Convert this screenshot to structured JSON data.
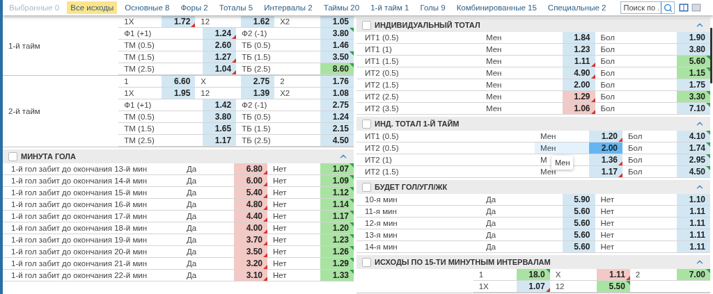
{
  "nav": {
    "tabs": [
      {
        "label": "Выбранные 0",
        "selected": false,
        "disabled": true
      },
      {
        "label": "Все исходы",
        "selected": true,
        "disabled": false
      },
      {
        "label": "Основные 8",
        "selected": false,
        "disabled": false
      },
      {
        "label": "Форы 2",
        "selected": false,
        "disabled": false
      },
      {
        "label": "Тоталы 5",
        "selected": false,
        "disabled": false
      },
      {
        "label": "Интервалы 2",
        "selected": false,
        "disabled": false
      },
      {
        "label": "Таймы 20",
        "selected": false,
        "disabled": false
      },
      {
        "label": "1-й тайм 1",
        "selected": false,
        "disabled": false
      },
      {
        "label": "Голы 9",
        "selected": false,
        "disabled": false
      },
      {
        "label": "Комбинированные 15",
        "selected": false,
        "disabled": false
      },
      {
        "label": "Специальные 2",
        "selected": false,
        "disabled": false
      }
    ],
    "search": {
      "placeholder": "Поиск по ."
    },
    "view_modes": [
      {
        "selected": true
      },
      {
        "selected": false
      }
    ]
  },
  "columns": [
    [
      {
        "kind": "periods",
        "periods": [
          {
            "label": "1-й тайм",
            "rows": [
              {
                "kind": "three",
                "outcomes": [
                  {
                    "label": "1X",
                    "odd": "1.72",
                    "color": "#d3e7f3",
                    "rising": false,
                    "falling": true
                  },
                  {
                    "label": "12",
                    "odd": "1.62",
                    "color": "#d3e7f3",
                    "rising": false,
                    "falling": false
                  },
                  {
                    "label": "X2",
                    "odd": "1.05",
                    "color": "#d3e7f3",
                    "rising": false,
                    "falling": false
                  }
                ]
              },
              {
                "kind": "two",
                "outcomes": [
                  {
                    "label": "Ф1 (+1)",
                    "odd": "1.24",
                    "color": "#d3e7f3",
                    "rising": false,
                    "falling": true
                  },
                  {
                    "label": "Ф2 (-1)",
                    "odd": "3.80",
                    "color": "#d3e7f3",
                    "rising": true,
                    "falling": false
                  }
                ]
              },
              {
                "kind": "two",
                "outcomes": [
                  {
                    "label": "ТМ (0.5)",
                    "odd": "2.60",
                    "color": "#d3e7f3",
                    "rising": false,
                    "falling": false
                  },
                  {
                    "label": "ТБ (0.5)",
                    "odd": "1.46",
                    "color": "#d3e7f3",
                    "rising": false,
                    "falling": false
                  }
                ]
              },
              {
                "kind": "two",
                "outcomes": [
                  {
                    "label": "ТМ (1.5)",
                    "odd": "1.27",
                    "color": "#d3e7f3",
                    "rising": false,
                    "falling": true
                  },
                  {
                    "label": "ТБ (1.5)",
                    "odd": "3.50",
                    "color": "#d3e7f3",
                    "rising": true,
                    "falling": false
                  }
                ]
              },
              {
                "kind": "two",
                "outcomes": [
                  {
                    "label": "ТМ (2.5)",
                    "odd": "1.04",
                    "color": "#d3e7f3",
                    "rising": false,
                    "falling": true
                  },
                  {
                    "label": "ТБ (2.5)",
                    "odd": "8.60",
                    "color": "#a9e3a2",
                    "rising": true,
                    "falling": false
                  }
                ]
              }
            ]
          },
          {
            "label": "2-й тайм",
            "rows": [
              {
                "kind": "three",
                "outcomes": [
                  {
                    "label": "1",
                    "odd": "6.60",
                    "color": "#d3e7f3",
                    "rising": false,
                    "falling": false
                  },
                  {
                    "label": "X",
                    "odd": "2.75",
                    "color": "#d3e7f3",
                    "rising": false,
                    "falling": false
                  },
                  {
                    "label": "2",
                    "odd": "1.76",
                    "color": "#d3e7f3",
                    "rising": false,
                    "falling": false
                  }
                ]
              },
              {
                "kind": "three",
                "outcomes": [
                  {
                    "label": "1X",
                    "odd": "1.95",
                    "color": "#d3e7f3",
                    "rising": false,
                    "falling": false
                  },
                  {
                    "label": "12",
                    "odd": "1.39",
                    "color": "#d3e7f3",
                    "rising": false,
                    "falling": false
                  },
                  {
                    "label": "X2",
                    "odd": "1.08",
                    "color": "#d3e7f3",
                    "rising": false,
                    "falling": false
                  }
                ]
              },
              {
                "kind": "two",
                "outcomes": [
                  {
                    "label": "Ф1 (+1)",
                    "odd": "1.42",
                    "color": "#d3e7f3",
                    "rising": false,
                    "falling": false
                  },
                  {
                    "label": "Ф2 (-1)",
                    "odd": "2.75",
                    "color": "#d3e7f3",
                    "rising": false,
                    "falling": false
                  }
                ]
              },
              {
                "kind": "two",
                "outcomes": [
                  {
                    "label": "ТМ (0.5)",
                    "odd": "3.80",
                    "color": "#d3e7f3",
                    "rising": false,
                    "falling": false
                  },
                  {
                    "label": "ТБ (0.5)",
                    "odd": "1.24",
                    "color": "#d3e7f3",
                    "rising": false,
                    "falling": false
                  }
                ]
              },
              {
                "kind": "two",
                "outcomes": [
                  {
                    "label": "ТМ (1.5)",
                    "odd": "1.65",
                    "color": "#d3e7f3",
                    "rising": false,
                    "falling": false
                  },
                  {
                    "label": "ТБ (1.5)",
                    "odd": "2.15",
                    "color": "#d3e7f3",
                    "rising": false,
                    "falling": false
                  }
                ]
              },
              {
                "kind": "two",
                "outcomes": [
                  {
                    "label": "ТМ (2.5)",
                    "odd": "1.17",
                    "color": "#d3e7f3",
                    "rising": false,
                    "falling": false
                  },
                  {
                    "label": "ТБ (2.5)",
                    "odd": "4.50",
                    "color": "#d3e7f3",
                    "rising": false,
                    "falling": false
                  }
                ]
              }
            ]
          }
        ]
      },
      {
        "kind": "props",
        "title": "МИНУТА ГОЛА",
        "checked": false,
        "expanded": true,
        "rows": [
          {
            "name": "1-й гол забит до окончания 13-й мин",
            "outcomes": [
              {
                "label": "Да",
                "odd": "6.80",
                "color": "#f2c9c5",
                "rising": false,
                "falling": true
              },
              {
                "label": "Нет",
                "odd": "1.07",
                "color": "#a9e3a2",
                "rising": true,
                "falling": false
              }
            ]
          },
          {
            "name": "1-й гол забит до окончания 14-й мин",
            "outcomes": [
              {
                "label": "Да",
                "odd": "6.00",
                "color": "#f2c9c5",
                "rising": false,
                "falling": true
              },
              {
                "label": "Нет",
                "odd": "1.09",
                "color": "#a9e3a2",
                "rising": true,
                "falling": false
              }
            ]
          },
          {
            "name": "1-й гол забит до окончания 15-й мин",
            "outcomes": [
              {
                "label": "Да",
                "odd": "5.40",
                "color": "#f2c9c5",
                "rising": false,
                "falling": true
              },
              {
                "label": "Нет",
                "odd": "1.12",
                "color": "#a9e3a2",
                "rising": true,
                "falling": false
              }
            ]
          },
          {
            "name": "1-й гол забит до окончания 16-й мин",
            "outcomes": [
              {
                "label": "Да",
                "odd": "4.80",
                "color": "#f2c9c5",
                "rising": false,
                "falling": true
              },
              {
                "label": "Нет",
                "odd": "1.14",
                "color": "#a9e3a2",
                "rising": true,
                "falling": false
              }
            ]
          },
          {
            "name": "1-й гол забит до окончания 17-й мин",
            "outcomes": [
              {
                "label": "Да",
                "odd": "4.40",
                "color": "#f2c9c5",
                "rising": false,
                "falling": true
              },
              {
                "label": "Нет",
                "odd": "1.17",
                "color": "#a9e3a2",
                "rising": true,
                "falling": false
              }
            ]
          },
          {
            "name": "1-й гол забит до окончания 18-й мин",
            "outcomes": [
              {
                "label": "Да",
                "odd": "4.00",
                "color": "#f2c9c5",
                "rising": false,
                "falling": true
              },
              {
                "label": "Нет",
                "odd": "1.20",
                "color": "#a9e3a2",
                "rising": true,
                "falling": false
              }
            ]
          },
          {
            "name": "1-й гол забит до окончания 19-й мин",
            "outcomes": [
              {
                "label": "Да",
                "odd": "3.70",
                "color": "#f2c9c5",
                "rising": false,
                "falling": true
              },
              {
                "label": "Нет",
                "odd": "1.23",
                "color": "#a9e3a2",
                "rising": true,
                "falling": false
              }
            ]
          },
          {
            "name": "1-й гол забит до окончания 20-й мин",
            "outcomes": [
              {
                "label": "Да",
                "odd": "3.50",
                "color": "#f2c9c5",
                "rising": false,
                "falling": true
              },
              {
                "label": "Нет",
                "odd": "1.26",
                "color": "#a9e3a2",
                "rising": true,
                "falling": false
              }
            ]
          },
          {
            "name": "1-й гол забит до окончания 21-й мин",
            "outcomes": [
              {
                "label": "Да",
                "odd": "3.20",
                "color": "#f2c9c5",
                "rising": false,
                "falling": true
              },
              {
                "label": "Нет",
                "odd": "1.29",
                "color": "#a9e3a2",
                "rising": true,
                "falling": false
              }
            ]
          },
          {
            "name": "1-й гол забит до окончания 22-й мин",
            "outcomes": [
              {
                "label": "Да",
                "odd": "3.10",
                "color": "#f2c9c5",
                "rising": false,
                "falling": true
              },
              {
                "label": "Нет",
                "odd": "1.33",
                "color": "#a9e3a2",
                "rising": true,
                "falling": false
              }
            ]
          }
        ]
      }
    ],
    [
      {
        "kind": "totals",
        "title": "ИНДИВИДУАЛЬНЫЙ ТОТАЛ",
        "checked": false,
        "expanded": true,
        "rows": [
          {
            "name": "ИТ1 (0.5)",
            "outcomes": [
              {
                "label": "Мен",
                "odd": "1.84",
                "color": "#d3e7f3",
                "rising": false,
                "falling": false
              },
              {
                "label": "Бол",
                "odd": "1.90",
                "color": "#d3e7f3",
                "rising": false,
                "falling": false
              }
            ]
          },
          {
            "name": "ИТ1 (1)",
            "outcomes": [
              {
                "label": "Мен",
                "odd": "1.23",
                "color": "#d3e7f3",
                "rising": false,
                "falling": false
              },
              {
                "label": "Бол",
                "odd": "3.80",
                "color": "#d3e7f3",
                "rising": false,
                "falling": false
              }
            ]
          },
          {
            "name": "ИТ1 (1.5)",
            "outcomes": [
              {
                "label": "Мен",
                "odd": "1.11",
                "color": "#d3e7f3",
                "rising": false,
                "falling": true
              },
              {
                "label": "Бол",
                "odd": "5.60",
                "color": "#a9e3a2",
                "rising": true,
                "falling": false
              }
            ]
          },
          {
            "name": "ИТ2 (0.5)",
            "outcomes": [
              {
                "label": "Мен",
                "odd": "4.90",
                "color": "#d3e7f3",
                "rising": false,
                "falling": true
              },
              {
                "label": "Бол",
                "odd": "1.15",
                "color": "#a9e3a2",
                "rising": true,
                "falling": false
              }
            ]
          },
          {
            "name": "ИТ2 (1.5)",
            "outcomes": [
              {
                "label": "Мен",
                "odd": "2.00",
                "color": "#d3e7f3",
                "rising": false,
                "falling": false
              },
              {
                "label": "Бол",
                "odd": "1.75",
                "color": "#d3e7f3",
                "rising": false,
                "falling": false
              }
            ]
          },
          {
            "name": "ИТ2 (2.5)",
            "outcomes": [
              {
                "label": "Мен",
                "odd": "1.29",
                "color": "#f2c9c5",
                "rising": false,
                "falling": true
              },
              {
                "label": "Бол",
                "odd": "3.30",
                "color": "#a9e3a2",
                "rising": true,
                "falling": false
              }
            ]
          },
          {
            "name": "ИТ2 (3.5)",
            "outcomes": [
              {
                "label": "Мен",
                "odd": "1.06",
                "color": "#f2c9c5",
                "rising": false,
                "falling": true
              },
              {
                "label": "Бол",
                "odd": "7.10",
                "color": "#d3e7f3",
                "rising": true,
                "falling": false
              }
            ]
          }
        ]
      },
      {
        "kind": "props",
        "title": "ИНД. ТОТАЛ 1-Й ТАЙМ",
        "checked": false,
        "expanded": true,
        "rows": [
          {
            "name": "ИТ1 (0.5)",
            "outcomes": [
              {
                "label": "Мен",
                "odd": "1.20",
                "color": "#d3e7f3",
                "rising": false,
                "falling": true,
                "hovered": false
              },
              {
                "label": "Бол",
                "odd": "4.10",
                "color": "#d3e7f3",
                "rising": true,
                "falling": false,
                "hovered": false
              }
            ]
          },
          {
            "name": "ИТ2 (0.5)",
            "outcomes": [
              {
                "label": "Мен",
                "odd": "2.00",
                "color": "#64b6f2",
                "rising": false,
                "falling": false,
                "hovered": true
              },
              {
                "label": "Бол",
                "odd": "1.74",
                "color": "#d3e7f3",
                "rising": true,
                "falling": false,
                "hovered": false
              }
            ]
          },
          {
            "name": "ИТ2 (1)",
            "outcomes": [
              {
                "label": "М",
                "tooltip": "Мен",
                "odd": "1.36",
                "color": "#d3e7f3",
                "rising": false,
                "falling": true,
                "hovered": false
              },
              {
                "label": "Бол",
                "odd": "2.95",
                "color": "#d3e7f3",
                "rising": true,
                "falling": false,
                "hovered": false
              }
            ]
          },
          {
            "name": "ИТ2 (1.5)",
            "outcomes": [
              {
                "label": "Мен",
                "odd": "1.17",
                "color": "#d3e7f3",
                "rising": false,
                "falling": true,
                "hovered": false
              },
              {
                "label": "Бол",
                "odd": "4.50",
                "color": "#d3e7f3",
                "rising": true,
                "falling": false,
                "hovered": false
              }
            ]
          }
        ]
      },
      {
        "kind": "totals",
        "title": "БУДЕТ ГОЛ/УГЛ/ЖК",
        "checked": false,
        "expanded": true,
        "rows": [
          {
            "name": "10-я мин",
            "outcomes": [
              {
                "label": "Да",
                "odd": "5.90",
                "color": "#d3e7f3",
                "rising": false,
                "falling": false
              },
              {
                "label": "Нет",
                "odd": "1.10",
                "color": "#d3e7f3",
                "rising": false,
                "falling": false
              }
            ]
          },
          {
            "name": "11-я мин",
            "outcomes": [
              {
                "label": "Да",
                "odd": "5.60",
                "color": "#d3e7f3",
                "rising": false,
                "falling": false
              },
              {
                "label": "Нет",
                "odd": "1.11",
                "color": "#d3e7f3",
                "rising": false,
                "falling": false
              }
            ]
          },
          {
            "name": "12-я мин",
            "outcomes": [
              {
                "label": "Да",
                "odd": "5.60",
                "color": "#d3e7f3",
                "rising": false,
                "falling": false
              },
              {
                "label": "Нет",
                "odd": "1.11",
                "color": "#d3e7f3",
                "rising": false,
                "falling": false
              }
            ]
          },
          {
            "name": "13-я мин",
            "outcomes": [
              {
                "label": "Да",
                "odd": "5.60",
                "color": "#d3e7f3",
                "rising": false,
                "falling": false
              },
              {
                "label": "Нет",
                "odd": "1.11",
                "color": "#d3e7f3",
                "rising": false,
                "falling": false
              }
            ]
          },
          {
            "name": "14-я мин",
            "outcomes": [
              {
                "label": "Да",
                "odd": "5.60",
                "color": "#d3e7f3",
                "rising": false,
                "falling": false
              },
              {
                "label": "Нет",
                "odd": "1.11",
                "color": "#d3e7f3",
                "rising": false,
                "falling": false
              }
            ]
          }
        ]
      },
      {
        "kind": "periods",
        "title": "ИСХОДЫ ПО 15-ТИ МИНУТНЫМ ИНТЕРВАЛАМ",
        "checked": false,
        "expanded": true,
        "periods": [
          {
            "rows": [
              {
                "kind": "three",
                "outcomes": [
                  {
                    "label": "1",
                    "odd": "18.0",
                    "color": "#a9e3a2",
                    "rising": true,
                    "falling": false
                  },
                  {
                    "label": "X",
                    "odd": "1.11",
                    "color": "#f2c9c5",
                    "rising": false,
                    "falling": true
                  },
                  {
                    "label": "2",
                    "odd": "7.00",
                    "color": "#a9e3a2",
                    "rising": true,
                    "falling": false
                  }
                ]
              },
              {
                "kind": "three",
                "outcomes": [
                  {
                    "label": "1X",
                    "odd": "1.07",
                    "color": "#d3e7f3",
                    "rising": false,
                    "falling": true
                  },
                  {
                    "label": "12",
                    "odd": "5.50",
                    "color": "#a9e3a2",
                    "rising": true,
                    "falling": false
                  }
                ]
              }
            ]
          }
        ]
      }
    ]
  ]
}
